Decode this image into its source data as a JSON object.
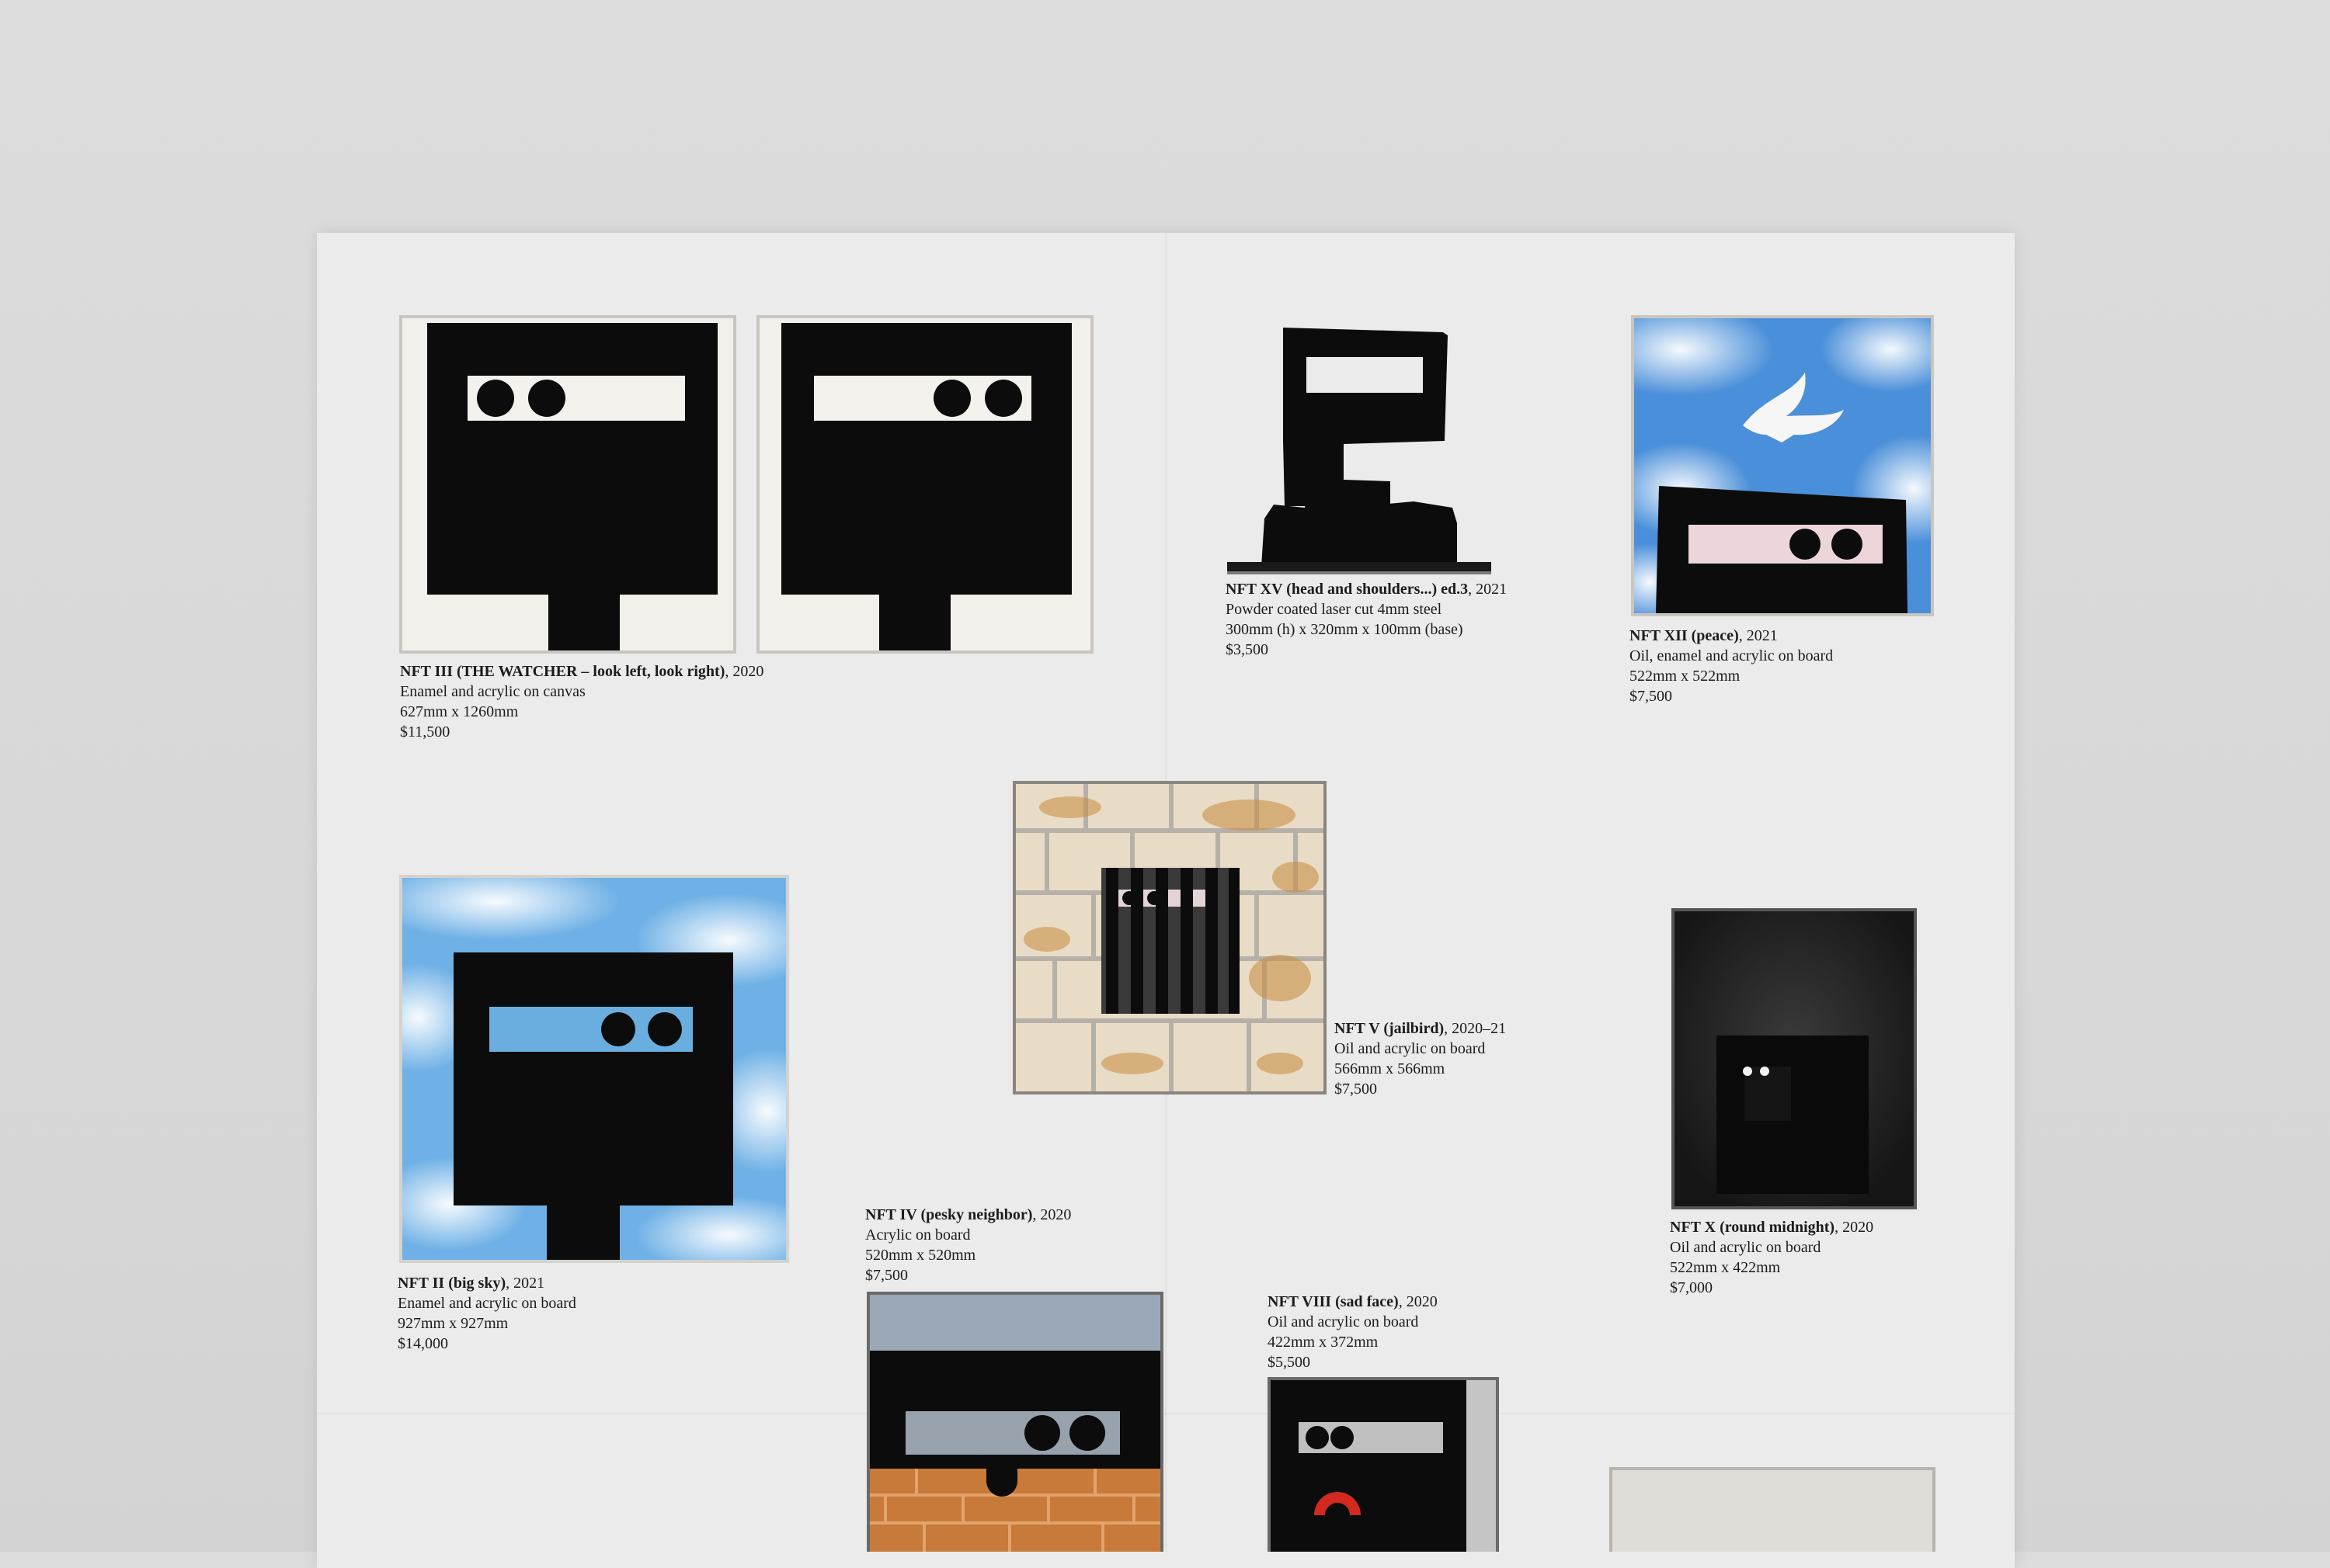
{
  "artworks": [
    {
      "title": "NFT III (THE WATCHER – look left, look right)",
      "year": ", 2020",
      "medium": "Enamel and acrylic on canvas",
      "size": "627mm x 1260mm",
      "price": "$11,500"
    },
    {
      "title": "NFT XV (head and shoulders...) ed.3",
      "year": ", 2021",
      "medium": "Powder coated laser cut 4mm steel",
      "size": "300mm (h) x 320mm x 100mm (base)",
      "price": "$3,500"
    },
    {
      "title": "NFT XII (peace)",
      "year": ", 2021",
      "medium": "Oil, enamel and acrylic on board",
      "size": "522mm x 522mm",
      "price": "$7,500"
    },
    {
      "title": "NFT V (jailbird)",
      "year": ", 2020–21",
      "medium": "Oil and acrylic on board",
      "size": "566mm x 566mm",
      "price": "$7,500"
    },
    {
      "title": "NFT II (big sky)",
      "year": ", 2021",
      "medium": "Enamel and acrylic on board",
      "size": "927mm x 927mm",
      "price": "$14,000"
    },
    {
      "title": "NFT IV (pesky neighbor)",
      "year": ", 2020",
      "medium": "Acrylic on board",
      "size": "520mm x 520mm",
      "price": "$7,500"
    },
    {
      "title": "NFT X (round midnight)",
      "year": ", 2020",
      "medium": "Oil and acrylic on board",
      "size": "522mm x 422mm",
      "price": "$7,000"
    },
    {
      "title": "NFT VIII (sad face)",
      "year": ", 2020",
      "medium": "Oil and acrylic on board",
      "size": "422mm x 372mm",
      "price": "$5,500"
    }
  ],
  "colors": {
    "sheet": "#ebebeb",
    "ink": "#0c0c0c",
    "sky": "#4a8fd9",
    "brick": "#c77a3a",
    "smile": "#d22a1e"
  }
}
